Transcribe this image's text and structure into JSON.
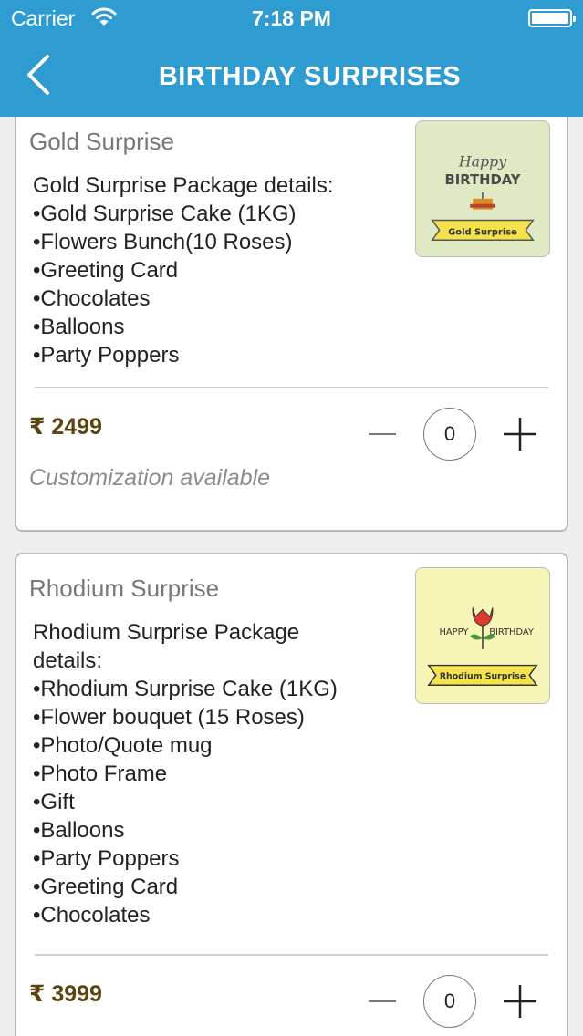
{
  "status_bar": {
    "carrier": "Carrier",
    "time": "7:18 PM",
    "icons": [
      "wifi-icon",
      "battery-icon"
    ]
  },
  "nav": {
    "title": "BIRTHDAY SURPRISES",
    "back_icon": "chevron-left-icon"
  },
  "packages": [
    {
      "name": "Gold Surprise",
      "details": [
        "Gold Surprise Package details:",
        "•Gold Surprise Cake (1KG)",
        "•Flowers Bunch(10 Roses)",
        "•Greeting Card",
        "•Chocolates",
        "•Balloons",
        "•Party Poppers"
      ],
      "thumbnail": {
        "line1": "Happy",
        "line2": "BIRTHDAY",
        "banner": "Gold Surprise",
        "background": "#dfeac4"
      },
      "price": "₹ 2499",
      "quantity": "0",
      "customization": "Customization available"
    },
    {
      "name": "Rhodium Surprise",
      "details": [
        "Rhodium Surprise Package",
        "details:",
        "•Rhodium Surprise Cake (1KG)",
        "•Flower bouquet (15 Roses)",
        "•Photo/Quote mug",
        "•Photo Frame",
        "•Gift",
        "•Balloons",
        "•Party Poppers",
        "•Greeting Card",
        "•Chocolates"
      ],
      "thumbnail": {
        "left_text": "HAPPY",
        "right_text": "BIRTHDAY",
        "banner": "Rhodium Surprise",
        "background": "#f6f4b7"
      },
      "price": "₹ 3999",
      "quantity": "0"
    }
  ],
  "colors": {
    "header": "#2e9cd0",
    "price": "#5a4410",
    "banner": "#f4e24a"
  }
}
